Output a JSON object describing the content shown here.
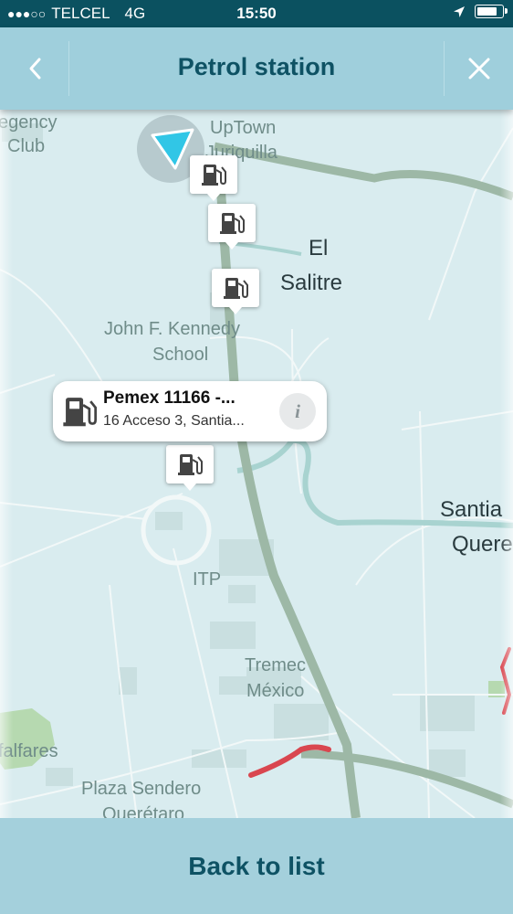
{
  "status_bar": {
    "carrier": "TELCEL",
    "network": "4G",
    "time": "15:50",
    "signal_bars": 3,
    "signal_total": 5,
    "battery_level": 0.8
  },
  "header": {
    "title": "Petrol station",
    "back_icon": "chevron-left-icon",
    "close_icon": "close-icon"
  },
  "map": {
    "labels": {
      "regency_club_1": "egency",
      "regency_club_2": "Club",
      "uptown_1": "UpTown",
      "uptown_2": "Juriquilla",
      "el_salitre_1": "El",
      "el_salitre_2": "Salitre",
      "jfk_1": "John F. Kennedy",
      "jfk_2": "School",
      "santiago_1": "Santia",
      "santiago_2": "Quere",
      "itp": "ITP",
      "tremec_1": "Tremec",
      "tremec_2": "México",
      "alfalfares": "falfares",
      "plaza_1": "Plaza Sendero",
      "plaza_2": "Querétaro"
    },
    "pin_icon": "fuel-pump-icon",
    "location_icon": "location-arrow-icon"
  },
  "callout": {
    "title": "Pemex 11166 -...",
    "address": "16 Acceso 3, Santia...",
    "info_label": "i"
  },
  "footer": {
    "back_to_list": "Back to list"
  },
  "colors": {
    "status_bar_bg": "#0b5160",
    "header_bg": "#9fcfdc",
    "title_text": "#0e5264",
    "map_bg": "#d9ecef",
    "highway": "#9db8a6",
    "traffic": "#d9464f",
    "location_arrow": "#31c6e6"
  }
}
